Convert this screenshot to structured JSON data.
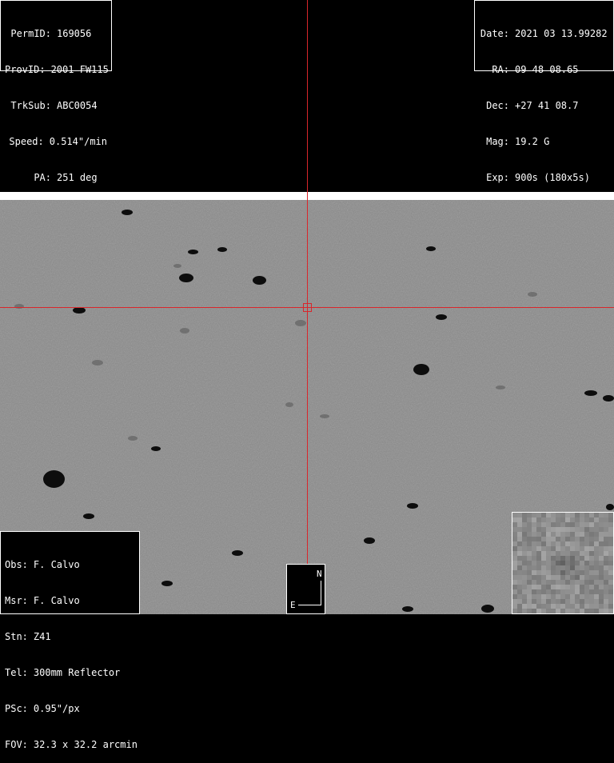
{
  "info_top_left": [
    {
      "key": "PermID:",
      "value": "169056"
    },
    {
      "key": "ProvID:",
      "value": "2001 FW115"
    },
    {
      "key": "TrkSub:",
      "value": "ABC0054"
    },
    {
      "key": "Speed:",
      "value": "0.514\"/min"
    },
    {
      "key": "PA:",
      "value": "251 deg"
    }
  ],
  "info_top_right": [
    {
      "key": "Date:",
      "value": "2021 03 13.99282"
    },
    {
      "key": "RA:",
      "value": "09 48 08.65"
    },
    {
      "key": "Dec:",
      "value": "+27 41 08.7"
    },
    {
      "key": "Mag:",
      "value": "19.2 G"
    },
    {
      "key": "Exp:",
      "value": "900s (180x5s)"
    }
  ],
  "info_bottom_left": [
    {
      "key": "Obs:",
      "value": "F. Calvo"
    },
    {
      "key": "Msr:",
      "value": "F. Calvo"
    },
    {
      "key": "Stn:",
      "value": "Z41"
    },
    {
      "key": "Tel:",
      "value": "300mm Reflector"
    },
    {
      "key": "PSc:",
      "value": "0.95\"/px"
    },
    {
      "key": "FOV:",
      "value": "32.3 x 32.2 arcmin"
    }
  ],
  "compass": {
    "north": "N",
    "east": "E"
  },
  "colors": {
    "crosshair": "#d9262b",
    "sky": "#8a8a8a",
    "panel_bg": "#000000",
    "panel_text": "#ffffff"
  }
}
